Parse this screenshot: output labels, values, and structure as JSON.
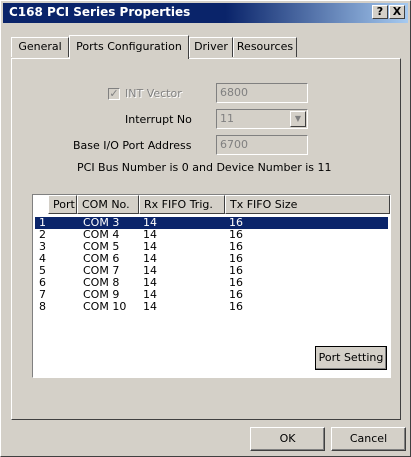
{
  "window": {
    "title": "C168 PCI Series Properties",
    "help_button": "?",
    "close_button": "X"
  },
  "tabs": [
    {
      "label": "General"
    },
    {
      "label": "Ports Configuration"
    },
    {
      "label": "Driver"
    },
    {
      "label": "Resources"
    }
  ],
  "active_tab": "Ports Configuration",
  "form": {
    "int_vector_label": "INT Vector",
    "int_vector_checked": true,
    "int_vector_value": "6800",
    "interrupt_label": "Interrupt No",
    "interrupt_value": "11",
    "base_io_label": "Base I/O Port Address",
    "base_io_value": "6700",
    "bus_info": "PCI Bus Number is 0 and Device Number is 11"
  },
  "ports_table": {
    "columns": [
      "Port",
      "COM No.",
      "Rx FIFO Trig.",
      "Tx FIFO Size"
    ],
    "rows": [
      [
        "1",
        "COM 3",
        "14",
        "16"
      ],
      [
        "2",
        "COM 4",
        "14",
        "16"
      ],
      [
        "3",
        "COM 5",
        "14",
        "16"
      ],
      [
        "4",
        "COM 6",
        "14",
        "16"
      ],
      [
        "5",
        "COM 7",
        "14",
        "16"
      ],
      [
        "6",
        "COM 8",
        "14",
        "16"
      ],
      [
        "7",
        "COM 9",
        "14",
        "16"
      ],
      [
        "8",
        "COM 10",
        "14",
        "16"
      ]
    ],
    "selected_row": 0
  },
  "buttons": {
    "port_setting": "Port Setting",
    "ok": "OK",
    "cancel": "Cancel"
  },
  "colors": {
    "title_bar": "#0a246a",
    "selection": "#0a246a",
    "face": "#d4d0c8"
  }
}
